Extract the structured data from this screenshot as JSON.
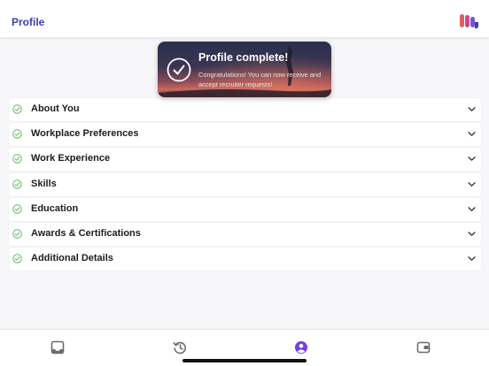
{
  "header": {
    "title": "Profile",
    "logo_icon": "brand-logo-icon"
  },
  "toast": {
    "title": "Profile complete!",
    "message": "Congratulations! You can now receive and accept recruiter requests!",
    "icon": "checkmark-circle-icon"
  },
  "sections": [
    {
      "label": "About You",
      "status": "complete"
    },
    {
      "label": "Workplace Preferences",
      "status": "complete"
    },
    {
      "label": "Work Experience",
      "status": "complete"
    },
    {
      "label": "Skills",
      "status": "complete"
    },
    {
      "label": "Education",
      "status": "complete"
    },
    {
      "label": "Awards & Certifications",
      "status": "complete"
    },
    {
      "label": "Additional Details",
      "status": "complete"
    }
  ],
  "tabbar": {
    "tabs": [
      {
        "name": "inbox",
        "icon": "inbox-icon",
        "active": false
      },
      {
        "name": "history",
        "icon": "history-icon",
        "active": false
      },
      {
        "name": "profile",
        "icon": "profile-icon",
        "active": true
      },
      {
        "name": "wallet",
        "icon": "wallet-icon",
        "active": false
      }
    ]
  },
  "colors": {
    "accent": "#3b3fb6",
    "active_tab": "#7a3fd6",
    "complete_check": "#5cb85c",
    "inactive_icon": "#6b6b70"
  }
}
